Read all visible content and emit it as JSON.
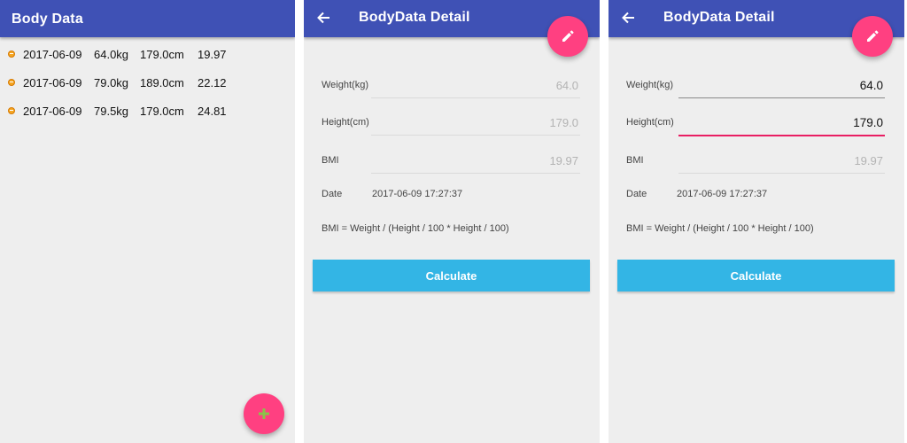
{
  "list_screen": {
    "title": "Body Data",
    "records": [
      {
        "date": "2017-06-09",
        "weight": "64.0kg",
        "height": "179.0cm",
        "bmi": "19.97"
      },
      {
        "date": "2017-06-09",
        "weight": "79.0kg",
        "height": "189.0cm",
        "bmi": "22.12"
      },
      {
        "date": "2017-06-09",
        "weight": "79.5kg",
        "height": "179.0cm",
        "bmi": "24.81"
      }
    ],
    "fab_icon": "plus-icon"
  },
  "detail_view": {
    "title": "BodyData Detail",
    "weight_label": "Weight(kg)",
    "weight_value": "64.0",
    "height_label": "Height(cm)",
    "height_value": "179.0",
    "bmi_label": "BMI",
    "bmi_value": "19.97",
    "date_label": "Date",
    "date_value": "2017-06-09 17:27:37",
    "formula": "BMI = Weight / (Height / 100 * Height / 100)",
    "calculate_label": "Calculate",
    "fab_icon": "edit-pencil-icon"
  },
  "detail_edit": {
    "title": "BodyData Detail",
    "weight_label": "Weight(kg)",
    "weight_value": "64.0",
    "height_label": "Height(cm)",
    "height_value": "179.0",
    "bmi_label": "BMI",
    "bmi_value": "19.97",
    "date_label": "Date",
    "date_value": "2017-06-09 17:27:37",
    "formula": "BMI = Weight / (Height / 100 * Height / 100)",
    "calculate_label": "Calculate",
    "fab_icon": "edit-pencil-icon"
  },
  "colors": {
    "app_bar": "#3f51b5",
    "fab": "#ff4081",
    "calculate_button": "#33b5e5",
    "focused_underline": "#e91e63",
    "list_dot": "#f5a623"
  }
}
